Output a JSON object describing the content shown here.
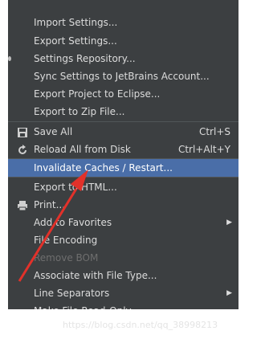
{
  "menu": {
    "items": [
      {
        "label": "Import Settings..."
      },
      {
        "label": "Export Settings..."
      },
      {
        "label": "Settings Repository..."
      },
      {
        "label": "Sync Settings to JetBrains Account..."
      },
      {
        "label": "Export Project to Eclipse..."
      },
      {
        "label": "Export to Zip File..."
      },
      {
        "label": "Save All",
        "shortcut": "Ctrl+S",
        "icon": "save-icon"
      },
      {
        "label": "Reload All from Disk",
        "shortcut": "Ctrl+Alt+Y",
        "icon": "reload-icon"
      },
      {
        "label": "Invalidate Caches / Restart..."
      },
      {
        "label": "Export to HTML..."
      },
      {
        "label": "Print...",
        "icon": "print-icon"
      },
      {
        "label": "Add to Favorites",
        "submenu": true
      },
      {
        "label": "File Encoding"
      },
      {
        "label": "Remove BOM"
      },
      {
        "label": "Associate with File Type..."
      },
      {
        "label": "Line Separators",
        "submenu": true
      },
      {
        "label": "Make File Read-Only"
      }
    ]
  },
  "watermark": "https://blog.csdn.net/qq_38998213",
  "colors": {
    "menu_bg": "#3c3f41",
    "highlight": "#4a6ea8",
    "arrow": "#e2312a"
  }
}
